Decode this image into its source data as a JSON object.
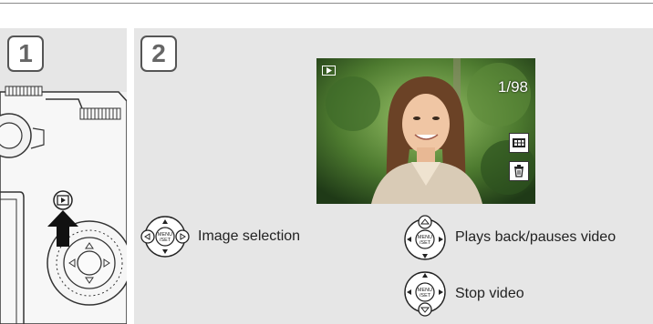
{
  "steps": {
    "step1_number": "1",
    "step2_number": "2"
  },
  "playback_screen": {
    "frame_counter": "1/98"
  },
  "controls": {
    "image_selection": "Image selection",
    "play_pause_video": "Plays back/pauses video",
    "stop_video": "Stop video"
  },
  "icons": {
    "playback_button": "playback-button-icon",
    "arrow": "up-arrow-icon",
    "cursor_pad_lr": "cursor-pad-left-right-icon",
    "cursor_pad_up": "cursor-pad-up-icon",
    "cursor_pad_down": "cursor-pad-down-icon",
    "thumbnail_view": "thumbnail-view-icon",
    "trash": "trash-icon"
  },
  "colors": {
    "panel_bg": "#e6e6e6",
    "badge_border": "#555555",
    "arrow_fill": "#111111"
  }
}
